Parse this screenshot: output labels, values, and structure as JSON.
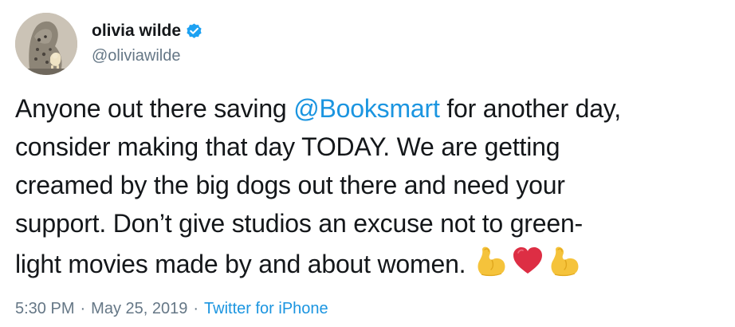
{
  "author": {
    "display_name": "olivia wilde",
    "handle": "@oliviawilde",
    "verified": true
  },
  "tweet": {
    "lines": [
      {
        "before": "Anyone out there saving ",
        "mention": "@Booksmart",
        "after": " for another day,"
      },
      {
        "text": "consider making that day TODAY. We are getting"
      },
      {
        "text": "creamed by the big dogs out there and need your"
      },
      {
        "text": "support. Don’t give studios an excuse not to green-"
      },
      {
        "text": "light movies made by and about women."
      }
    ],
    "emojis": [
      "flexed-biceps",
      "red-heart",
      "flexed-biceps"
    ]
  },
  "meta": {
    "time": "5:30 PM",
    "separator": "·",
    "date": "May 25, 2019",
    "source": "Twitter for iPhone"
  },
  "colors": {
    "text": "#14171a",
    "secondary": "#657786",
    "link": "#1b95e0",
    "verified": "#1da1f2"
  }
}
